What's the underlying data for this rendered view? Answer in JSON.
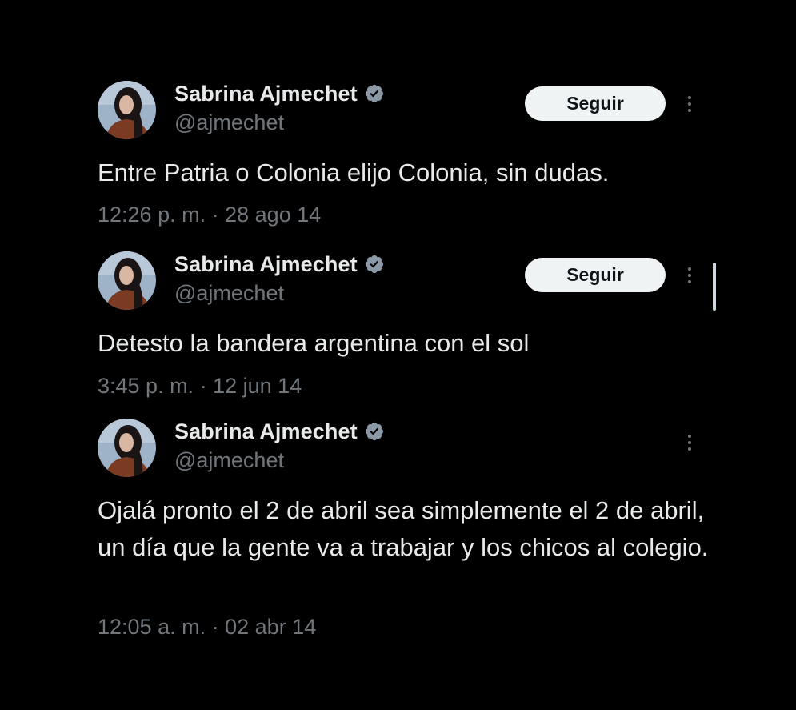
{
  "colors": {
    "background": "#000000",
    "primary_text": "#e7e9ea",
    "secondary_text": "#71767b",
    "verified_badge": "#8b98a5",
    "follow_button_bg": "#eff3f4",
    "follow_button_text": "#0f1419"
  },
  "icons": {
    "verified": "verified-badge-icon",
    "more": "more-options-icon"
  },
  "tweets": [
    {
      "author_name": "Sabrina Ajmechet",
      "handle": "@ajmechet",
      "follow_label": "Seguir",
      "text": "Entre Patria o Colonia elijo Colonia, sin dudas.",
      "time": "12:26 p. m.",
      "separator": "·",
      "date": "28 ago 14"
    },
    {
      "author_name": "Sabrina Ajmechet",
      "handle": "@ajmechet",
      "follow_label": "Seguir",
      "text": "Detesto la bandera argentina con el sol",
      "time": "3:45 p. m.",
      "separator": "·",
      "date": "12 jun 14"
    },
    {
      "author_name": "Sabrina Ajmechet",
      "handle": "@ajmechet",
      "text": "Ojalá pronto el 2 de abril sea simplemente el 2 de abril, un día que la gente va a trabajar y los chicos al colegio.",
      "time": "12:05 a. m.",
      "separator": "·",
      "date": "02 abr 14"
    }
  ]
}
